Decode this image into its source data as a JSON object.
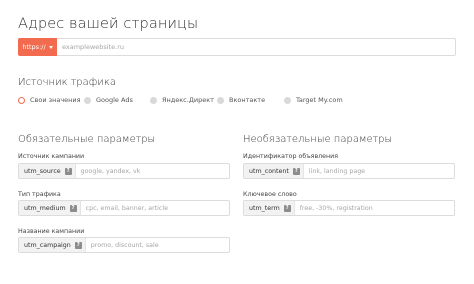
{
  "page": {
    "title": "Адрес вашей страницы"
  },
  "url": {
    "protocol": "https://",
    "placeholder": "examplewebsite.ru"
  },
  "source": {
    "title": "Источник трафика",
    "options": [
      {
        "label": "Свои значения",
        "selected": true
      },
      {
        "label": "Google Ads",
        "selected": false
      },
      {
        "label": "Яндекс.Директ",
        "selected": false
      },
      {
        "label": "Вконтакте",
        "selected": false
      },
      {
        "label": "Target My.com",
        "selected": false
      }
    ]
  },
  "required": {
    "title": "Обязательные параметры",
    "fields": [
      {
        "label": "Источник кампании",
        "param": "utm_source",
        "help": "?",
        "placeholder": "google, yandex, vk"
      },
      {
        "label": "Тип трафика",
        "param": "utm_medium",
        "help": "?",
        "placeholder": "cpc, email, banner, article"
      },
      {
        "label": "Название кампании",
        "param": "utm_campaign",
        "help": "?",
        "placeholder": "promo, discount, sale"
      }
    ]
  },
  "optional": {
    "title": "Необязательные параметры",
    "fields": [
      {
        "label": "Идентификатор объявления",
        "param": "utm_content",
        "help": "?",
        "placeholder": "link, landing page"
      },
      {
        "label": "Ключевое слово",
        "param": "utm_term",
        "help": "?",
        "placeholder": "free, -30%, registration"
      }
    ]
  },
  "colors": {
    "accent": "#f26b4f",
    "border": "#dcdcdc",
    "param_bg": "#f2f2f2"
  }
}
